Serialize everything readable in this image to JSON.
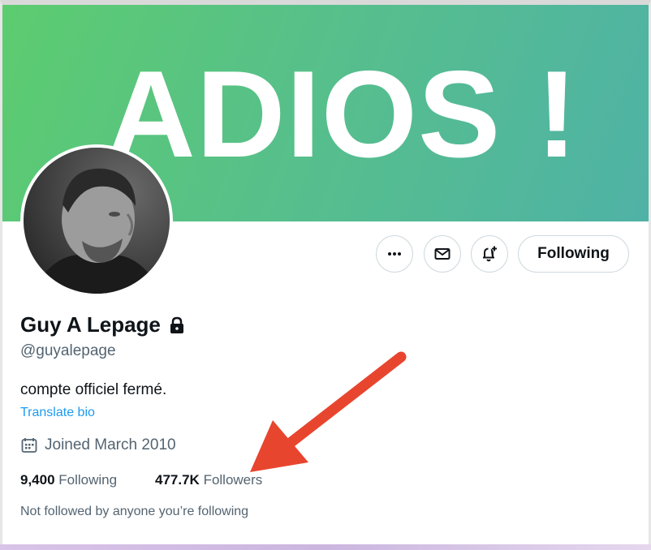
{
  "banner": {
    "text": "ADIOS !"
  },
  "profile": {
    "display_name": "Guy A Lepage",
    "handle": "@guyalepage",
    "bio": "compte officiel fermé.",
    "translate_label": "Translate bio",
    "joined": "Joined March 2010",
    "following_count": "9,400",
    "following_label": "Following",
    "followers_count": "477.7K",
    "followers_label": "Followers",
    "not_followed_text": "Not followed by anyone you’re following"
  },
  "actions": {
    "more_icon": "more-horizontal-icon",
    "message_icon": "envelope-icon",
    "notify_icon": "bell-plus-icon",
    "follow_label": "Following"
  },
  "colors": {
    "banner_start": "#5ccc6f",
    "banner_end": "#4fb2a6",
    "link": "#1d9bf0",
    "annotation_arrow": "#e8452f"
  }
}
